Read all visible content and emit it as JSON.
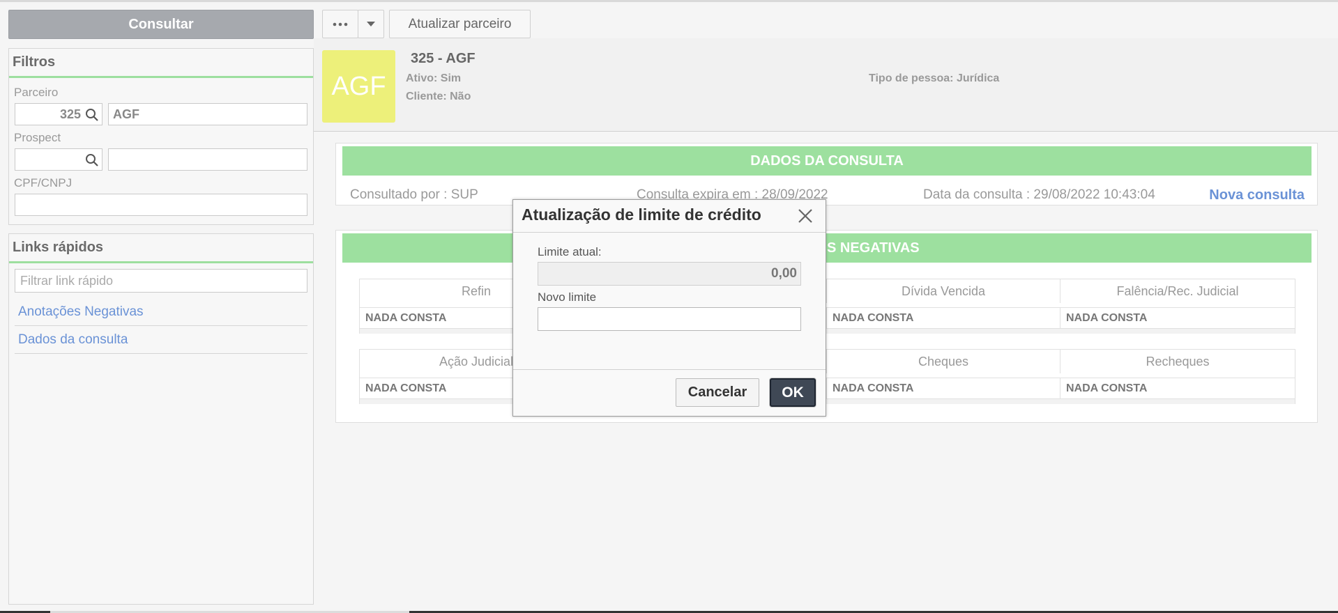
{
  "left": {
    "consultar_label": "Consultar",
    "filtros": {
      "title": "Filtros",
      "parceiro_label": "Parceiro",
      "parceiro_code": "325",
      "parceiro_name": "AGF",
      "prospect_label": "Prospect",
      "prospect_code": "",
      "prospect_name": "",
      "cpf_label": "CPF/CNPJ",
      "cpf_value": ""
    },
    "links": {
      "title": "Links rápidos",
      "filter_placeholder": "Filtrar link rápido",
      "items": [
        "Anotações Negativas",
        "Dados da consulta"
      ]
    }
  },
  "toolbar": {
    "more_icon": "ellipsis-icon",
    "dropdown_icon": "caret-down-icon",
    "atualizar_label": "Atualizar parceiro"
  },
  "partner": {
    "avatar_text": "AGF",
    "title": "325 - AGF",
    "ativo": "Ativo: Sim",
    "cliente": "Cliente: Não",
    "tipo_pessoa": "Tipo de pessoa: Jurídica",
    "avatar_color": "#edf07a"
  },
  "dados": {
    "header": "DADOS DA CONSULTA",
    "consultado_por": "Consultado por : SUP",
    "expira": "Consulta expira em : 28/09/2022",
    "data": "Data da consulta : 29/08/2022 10:43:04",
    "nova_consulta": "Nova consulta"
  },
  "negativas": {
    "header_visible": "S NEGATIVAS",
    "row1": {
      "headers": [
        "Refin",
        "",
        "Dívida Vencida",
        "Falência/Rec. Judicial"
      ],
      "values": [
        "NADA CONSTA",
        "",
        "NADA CONSTA",
        "NADA CONSTA"
      ]
    },
    "row2": {
      "headers": [
        "Ação Judicial",
        "",
        "Cheques",
        "Recheques"
      ],
      "values": [
        "NADA CONSTA",
        "",
        "NADA CONSTA",
        "NADA CONSTA"
      ]
    }
  },
  "modal": {
    "title": "Atualização de limite de crédito",
    "limite_atual_label": "Limite atual:",
    "limite_atual_value": "0,00",
    "novo_limite_label": "Novo limite",
    "novo_limite_value": "",
    "cancel_label": "Cancelar",
    "ok_label": "OK"
  },
  "colors": {
    "accent_green": "#9de09f",
    "link_blue": "#6a92d6",
    "ok_button": "#3f4855"
  }
}
